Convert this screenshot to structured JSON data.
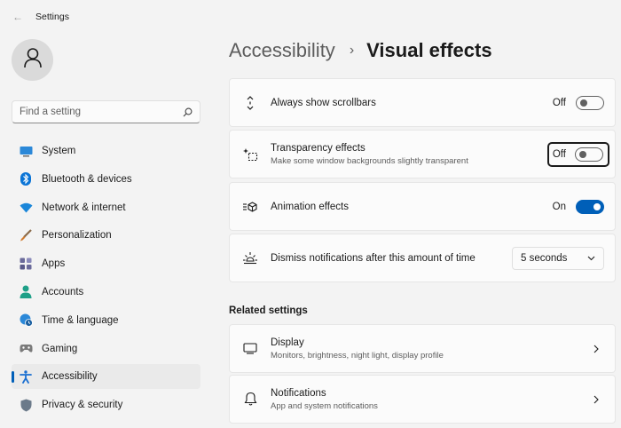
{
  "window": {
    "title": "Settings",
    "back_glyph": "←"
  },
  "sidebar": {
    "avatar_icon": "user-icon",
    "search": {
      "placeholder": "Find a setting",
      "value": ""
    },
    "items": [
      {
        "label": "System",
        "icon": "monitor-icon",
        "color": "#2b88d8"
      },
      {
        "label": "Bluetooth & devices",
        "icon": "bluetooth-icon",
        "color": "#0a74d6"
      },
      {
        "label": "Network & internet",
        "icon": "wifi-icon",
        "color": "#1a86d9"
      },
      {
        "label": "Personalization",
        "icon": "brush-icon",
        "color": "#d07a2e"
      },
      {
        "label": "Apps",
        "icon": "apps-icon",
        "color": "#5a5a8a"
      },
      {
        "label": "Accounts",
        "icon": "person-icon",
        "color": "#1ea088"
      },
      {
        "label": "Time & language",
        "icon": "globe-clock-icon",
        "color": "#2b88d8"
      },
      {
        "label": "Gaming",
        "icon": "gamepad-icon",
        "color": "#7a7a7a"
      },
      {
        "label": "Accessibility",
        "icon": "accessibility-icon",
        "color": "#1a6fd1",
        "active": true
      },
      {
        "label": "Privacy & security",
        "icon": "shield-icon",
        "color": "#6b7a8a"
      }
    ]
  },
  "breadcrumb": {
    "parent": "Accessibility",
    "separator": "›",
    "current": "Visual effects"
  },
  "settings": {
    "scrollbars": {
      "title": "Always show scrollbars",
      "state": "Off",
      "icon": "scroll-arrows-icon"
    },
    "transparency": {
      "title": "Transparency effects",
      "subtitle": "Make some window backgrounds slightly transparent",
      "state": "Off",
      "icon": "transparency-icon"
    },
    "animation": {
      "title": "Animation effects",
      "state": "On",
      "icon": "animation-icon"
    },
    "notifications": {
      "title": "Dismiss notifications after this amount of time",
      "value": "5 seconds",
      "icon": "sun-icon"
    }
  },
  "related": {
    "heading": "Related settings",
    "items": [
      {
        "title": "Display",
        "subtitle": "Monitors, brightness, night light, display profile",
        "icon": "display-icon"
      },
      {
        "title": "Notifications",
        "subtitle": "App and system notifications",
        "icon": "bell-icon"
      }
    ]
  },
  "colors": {
    "accent": "#005fb8",
    "background": "#f3f3f3",
    "card": "#fbfbfb"
  }
}
